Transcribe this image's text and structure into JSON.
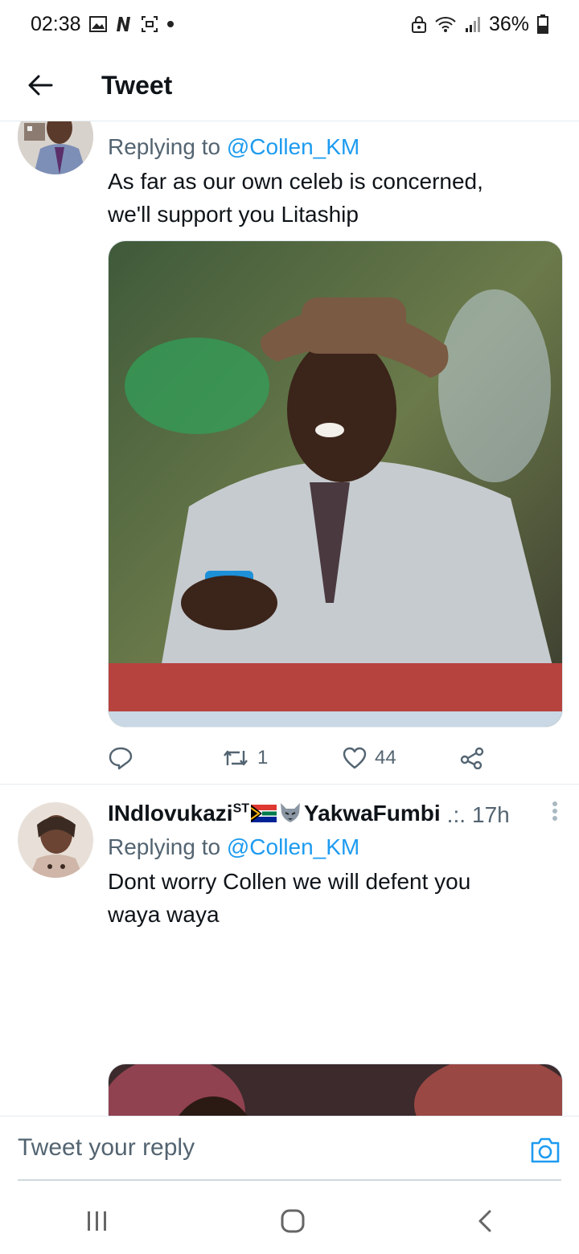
{
  "status_bar": {
    "time": "02:38",
    "battery": "36%",
    "left_icons": [
      "gallery-icon",
      "netflix-n-icon",
      "screenshot-icon",
      "dot-icon"
    ],
    "right_icons": [
      "lock-icon",
      "wifi-icon",
      "signal-icon",
      "battery-icon"
    ]
  },
  "header": {
    "title": "Tweet"
  },
  "tweets": [
    {
      "replying_prefix": "Replying to ",
      "replying_handle": "@Collen_KM",
      "text_line1": "As far as our own celeb is concerned,",
      "text_line2": "we'll support you Litaship",
      "actions": {
        "retweets": "1",
        "likes": "44"
      }
    },
    {
      "name_part1": "INdlovukazi",
      "name_super": "ST",
      "name_part2": "YakwaFumbi",
      "name_suffix": ".:.",
      "time": "17h",
      "replying_prefix": "Replying to ",
      "replying_handle": "@Collen_KM",
      "text_line1": "Dont worry Collen we will defent you",
      "text_line2": "waya waya"
    }
  ],
  "reply_bar": {
    "placeholder": "Tweet your reply"
  },
  "colors": {
    "accent": "#1d9bf0",
    "muted": "#536471",
    "text": "#0f1419"
  }
}
